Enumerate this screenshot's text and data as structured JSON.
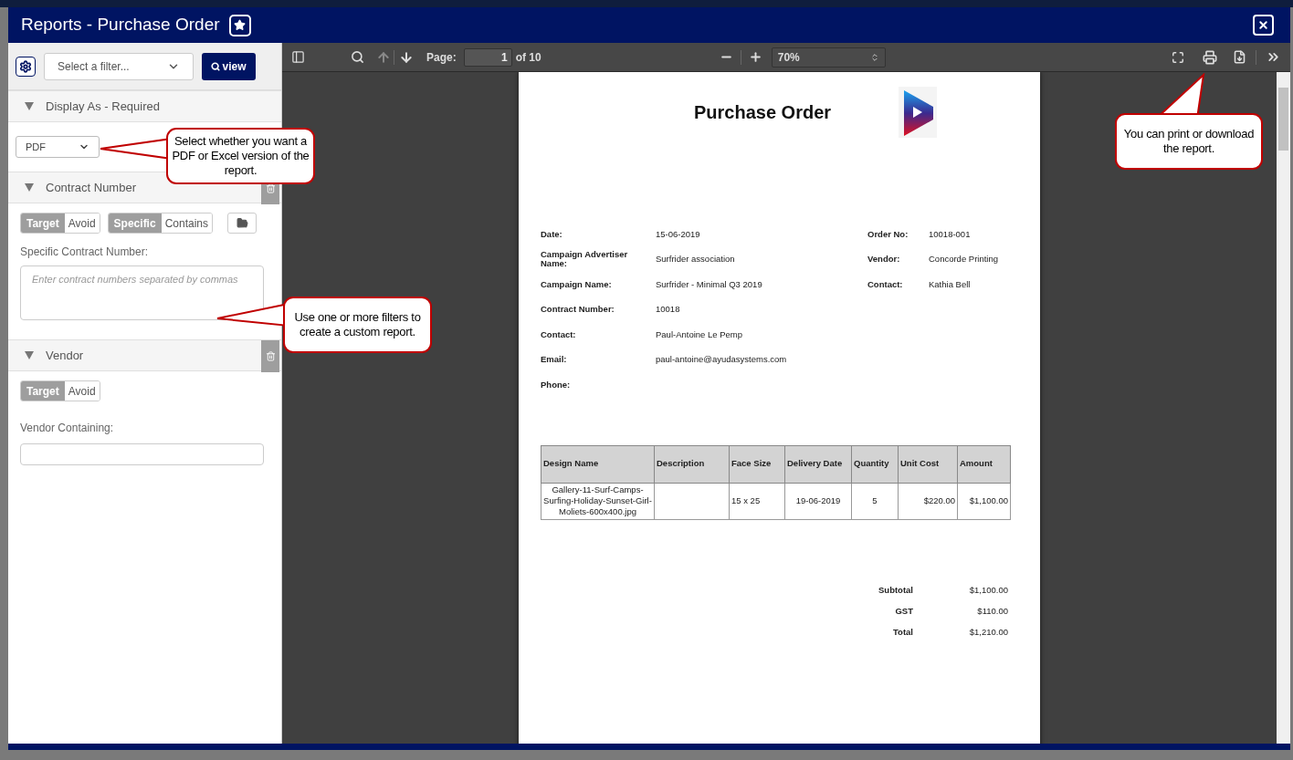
{
  "window": {
    "title": "Reports - Purchase Order"
  },
  "filter_bar": {
    "filter_select": {
      "placeholder": "Select a filter..."
    },
    "view_button": "view"
  },
  "sections": [
    {
      "kind": "select",
      "title": "Display As - Required",
      "expanded": true,
      "value": "PDF"
    },
    {
      "kind": "textarea",
      "title": "Contract Number",
      "expanded": true,
      "removable": true,
      "toggle_groups": [
        [
          {
            "label": "Target",
            "selected": true
          },
          {
            "label": "Avoid",
            "selected": false
          }
        ],
        [
          {
            "label": "Specific",
            "selected": true
          },
          {
            "label": "Contains",
            "selected": false
          }
        ]
      ],
      "browse_button": true,
      "field_label": "Specific Contract Number:",
      "placeholder": "Enter contract numbers separated by commas"
    },
    {
      "kind": "input",
      "title": "Vendor",
      "expanded": true,
      "removable": true,
      "toggle_groups": [
        [
          {
            "label": "Target",
            "selected": true
          },
          {
            "label": "Avoid",
            "selected": false
          }
        ]
      ],
      "field_label": "Vendor Containing:"
    }
  ],
  "viewer_toolbar": {
    "page_label": "Page:",
    "page": "1",
    "page_total": "of 10",
    "zoom": "70%"
  },
  "document": {
    "title": "Purchase Order",
    "details_left": [
      {
        "label": "Date:",
        "value": "15-06-2019"
      },
      {
        "label": "Campaign Advertiser Name:",
        "value": "Surfrider association"
      },
      {
        "label": "Campaign Name:",
        "value": "Surfrider - Minimal Q3 2019"
      },
      {
        "label": "Contract Number:",
        "value": "10018"
      },
      {
        "label": "Contact:",
        "value": "Paul-Antoine  Le Pemp"
      },
      {
        "label": "Email:",
        "value": "paul-antoine@ayudasystems.com"
      },
      {
        "label": "Phone:"
      }
    ],
    "details_right": [
      {
        "label": "Order No:",
        "value": "10018-001"
      },
      {
        "label": "Vendor:",
        "value": "Concorde Printing"
      },
      {
        "label": "Contact:",
        "value": "Kathia  Bell"
      }
    ],
    "table": {
      "columns": [
        "Design Name",
        "Description",
        "Face Size",
        "Delivery Date",
        "Quantity",
        "Unit Cost",
        "Amount"
      ],
      "rows": [
        [
          "Gallery-11-Surf-Camps-Surfing-Holiday-Sunset-Girl-Moliets-600x400.jpg",
          "",
          "15 x 25",
          "19-06-2019",
          "5",
          "$220.00",
          "$1,100.00"
        ]
      ]
    },
    "totals": [
      {
        "label": "Subtotal",
        "value": "$1,100.00"
      },
      {
        "label": "GST",
        "value": "$110.00"
      },
      {
        "label": "Total",
        "value": "$1,210.00"
      }
    ]
  },
  "callouts": [
    "Select whether you want a PDF or Excel version of the report.",
    "Use one or more filters to create a custom report.",
    "You can print or download the report."
  ]
}
